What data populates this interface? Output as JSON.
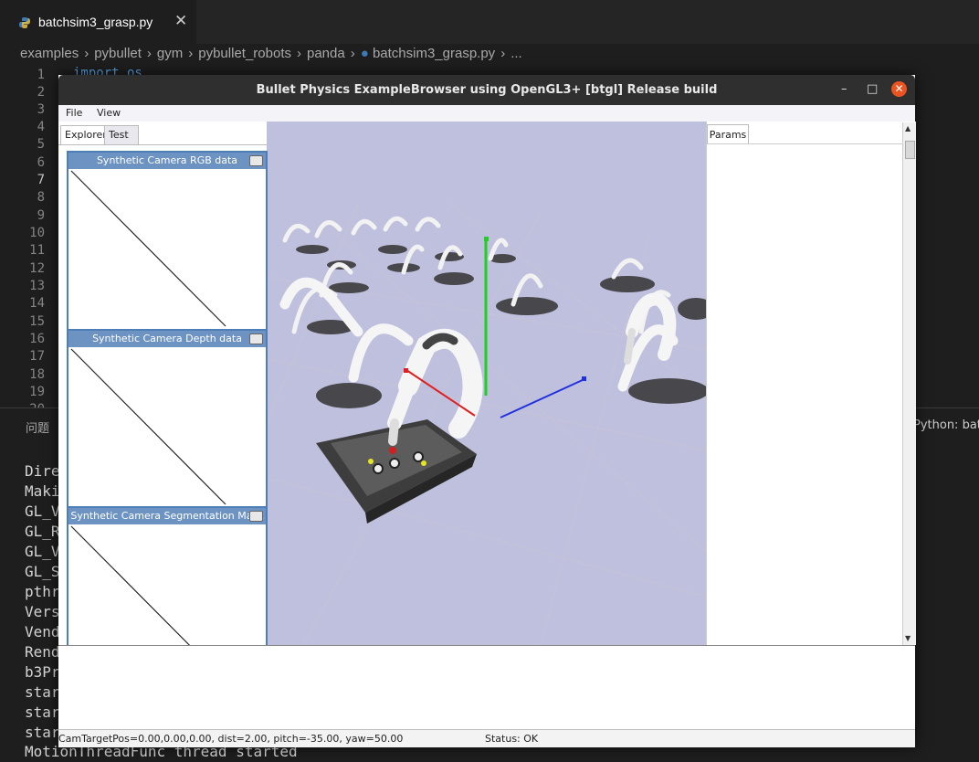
{
  "editor": {
    "tab_name": "batchsim3_grasp.py",
    "tab_close": "✕",
    "breadcrumb": [
      "examples",
      "pybullet",
      "gym",
      "pybullet_robots",
      "panda",
      "batchsim3_grasp.py",
      "..."
    ],
    "line_numbers": [
      "1",
      "2",
      "3",
      "4",
      "5",
      "6",
      "7",
      "8",
      "9",
      "10",
      "11",
      "12",
      "13",
      "14",
      "15",
      "16",
      "17",
      "18",
      "19",
      "20"
    ],
    "code_line_1": "import os"
  },
  "panel": {
    "title": "问题",
    "python_status": "Python: batc",
    "terminal_lines": [
      "Dire",
      "Maki",
      "GL_V",
      "GL_R",
      "GL_V",
      "GL_S",
      "pthr",
      "Vers",
      "Vend",
      "Rend",
      "b3Pr",
      "star",
      "star",
      "star"
    ],
    "terminal_last": "MotionThreadFunc thread started"
  },
  "bullet": {
    "title": "Bullet Physics ExampleBrowser using OpenGL3+ [btgl] Release build",
    "menu": [
      "File",
      "View"
    ],
    "left_tabs": [
      "Explorer",
      "Test"
    ],
    "right_tab": "Params",
    "camera_windows": [
      "Synthetic Camera RGB data",
      "Synthetic Camera Depth data",
      "Synthetic Camera Segmentation Mask"
    ],
    "status_camera": "CamTargetPos=0.00,0.00,0.00, dist=2.00, pitch=-35.00, yaw=50.00",
    "status_text": "Status: OK",
    "window_buttons": [
      "–",
      "□",
      "✕"
    ]
  },
  "colors": {
    "scene_bg": "#bfc0de",
    "accent_blue": "#4d7eb8",
    "close_orange": "#e95420",
    "x_axis": "#e02020",
    "y_axis": "#20d020",
    "z_axis": "#2030e0"
  },
  "icons": [
    "python-file-icon",
    "chevron-right-icon",
    "close-icon",
    "minimize-icon",
    "maximize-icon",
    "window-close-icon",
    "minimize-panel-icon"
  ]
}
